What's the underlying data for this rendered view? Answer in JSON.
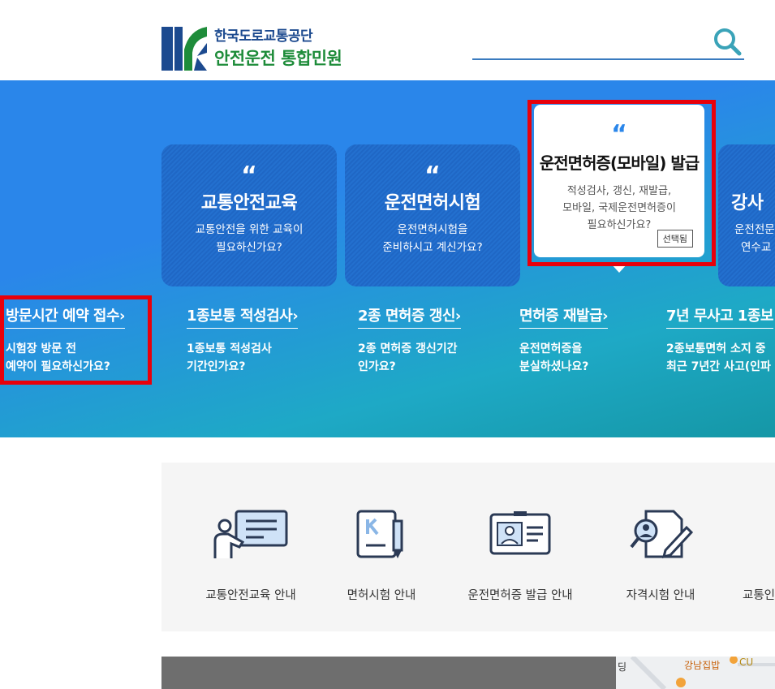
{
  "header": {
    "org_name": "한국도로교통공단",
    "site_name": "안전운전 통합민원",
    "search_placeholder": "",
    "search_icon": "search-icon"
  },
  "hero": {
    "cards": [
      {
        "quote": "“",
        "title": "교통안전교육",
        "desc_line1": "교통안전을 위한 교육이",
        "desc_line2": "필요하신가요?",
        "desc_line3": ""
      },
      {
        "quote": "“",
        "title": "운전면허시험",
        "desc_line1": "운전면허시험을",
        "desc_line2": "준비하시고 계신가요?",
        "desc_line3": ""
      },
      {
        "quote": "“",
        "title": "운전면허증(모바일) 발급",
        "desc_line1": "적성검사, 갱신, 재발급,",
        "desc_line2": "모바일, 국제운전면허증이",
        "desc_line3": "필요하신가요?",
        "badge": "선택됨"
      },
      {
        "quote": "“",
        "title": "강사",
        "desc_line1": "운전전문",
        "desc_line2": "연수교",
        "desc_line3": ""
      }
    ],
    "links": [
      {
        "title": "방문시간 예약 접수",
        "desc_line1": "시험장 방문 전",
        "desc_line2": "예약이 필요하신가요?"
      },
      {
        "title": "1종보통 적성검사",
        "desc_line1": "1종보통 적성검사",
        "desc_line2": "기간인가요?"
      },
      {
        "title": "2종 면허증 갱신",
        "desc_line1": "2종 면허증 갱신기간",
        "desc_line2": "인가요?"
      },
      {
        "title": "면허증 재발급",
        "desc_line1": "운전면허증을",
        "desc_line2": "분실하셨나요?"
      },
      {
        "title": "7년 무사고 1종보",
        "desc_line1": "2종보통면허 소지 중",
        "desc_line2": "최근 7년간 사고(인파"
      }
    ],
    "link_arrow": "›"
  },
  "quick_menu": [
    {
      "label": "교통안전교육 안내",
      "icon": "lecture-icon"
    },
    {
      "label": "면허시험 안내",
      "icon": "exam-book-icon"
    },
    {
      "label": "운전면허증 발급 안내",
      "icon": "license-card-icon"
    },
    {
      "label": "자격시험 안내",
      "icon": "qualification-search-icon"
    },
    {
      "label": "교통인",
      "icon": ""
    }
  ],
  "map": {
    "label1": "강남집밥",
    "label2": "CU",
    "label3": "딩"
  },
  "colors": {
    "brand_blue": "#1c4a8f",
    "brand_green": "#1e8c3a",
    "hero_top": "#2a86ea",
    "hero_bottom": "#1597a6",
    "highlight_red": "#e8000b"
  }
}
